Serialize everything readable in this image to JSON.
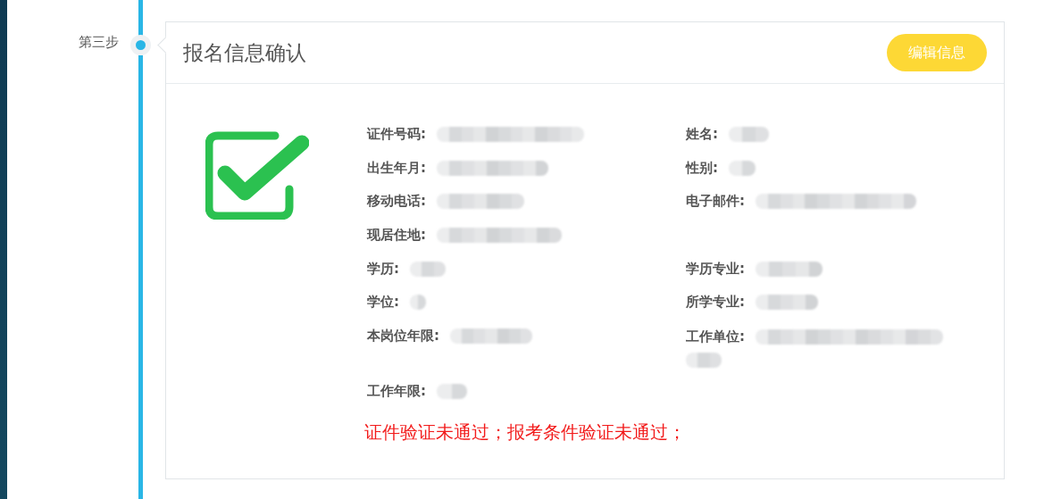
{
  "step": {
    "label": "第三步",
    "active": true
  },
  "card": {
    "title": "报名信息确认",
    "edit_button": "编辑信息",
    "verified": true
  },
  "rows": [
    [
      {
        "label": "证件号码:",
        "redacted": true
      },
      {
        "label": "姓名:",
        "redacted": true
      }
    ],
    [
      {
        "label": "出生年月:",
        "redacted": true
      },
      {
        "label": "性别:",
        "redacted": true
      }
    ],
    [
      {
        "label": "移动电话:",
        "redacted": true
      },
      {
        "label": "电子邮件:",
        "redacted": true
      }
    ],
    [
      {
        "label": "现居住地:",
        "redacted": true
      }
    ],
    [
      {
        "label": "学历:",
        "redacted": true
      },
      {
        "label": "学历专业:",
        "redacted": true
      }
    ],
    [
      {
        "label": "学位:",
        "redacted": true
      },
      {
        "label": "所学专业:",
        "redacted": true
      }
    ],
    [
      {
        "label": "本岗位年限:",
        "redacted": true
      },
      {
        "label": "工作单位:",
        "redacted": true,
        "wraps": true
      }
    ],
    [
      {
        "label": "工作年限:",
        "redacted": true
      }
    ]
  ],
  "error_message": "证件验证未通过；报考条件验证未通过；"
}
